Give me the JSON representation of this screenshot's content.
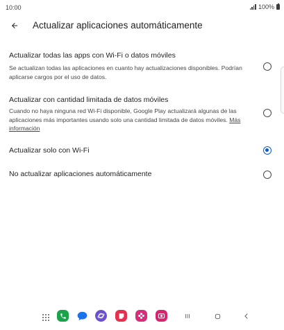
{
  "status_bar": {
    "time": "10:00",
    "battery": "100%"
  },
  "app_bar": {
    "title": "Actualizar aplicaciones automáticamente",
    "back_icon": "arrow-back-icon"
  },
  "options": [
    {
      "title": "Actualizar todas las apps con Wi-Fi o datos móviles",
      "description": "Se actualizan todas las aplicaciones en cuanto hay actualizaciones disponibles. Podrían aplicarse cargos por el uso de datos.",
      "selected": false
    },
    {
      "title": "Actualizar con cantidad limitada de datos móviles",
      "description": "Cuando no haya ninguna red Wi-Fi disponible, Google Play actualizará algunas de las aplicaciones más importantes usando solo una cantidad limitada de datos móviles.",
      "link": "Más información",
      "selected": false
    },
    {
      "title": "Actualizar solo con Wi-Fi",
      "selected": true
    },
    {
      "title": "No actualizar aplicaciones automáticamente",
      "selected": false
    }
  ],
  "colors": {
    "accent": "#0b57d0",
    "text_primary": "#1f1f1f",
    "text_secondary": "#444746"
  },
  "nav_bar": {
    "apps": [
      {
        "icon": "phone-app-icon",
        "color": "#1aa34a"
      },
      {
        "icon": "messages-app-icon",
        "color": "#1a73e8"
      },
      {
        "icon": "internet-app-icon",
        "color": "#6f4fd1"
      },
      {
        "icon": "notes-app-icon",
        "color": "#e5304d"
      },
      {
        "icon": "gallery-app-icon",
        "color": "#d62e7b"
      },
      {
        "icon": "camera-app-icon",
        "color": "#d6246d"
      }
    ],
    "buttons": [
      "recent-apps-icon",
      "home-icon",
      "back-nav-icon"
    ]
  }
}
